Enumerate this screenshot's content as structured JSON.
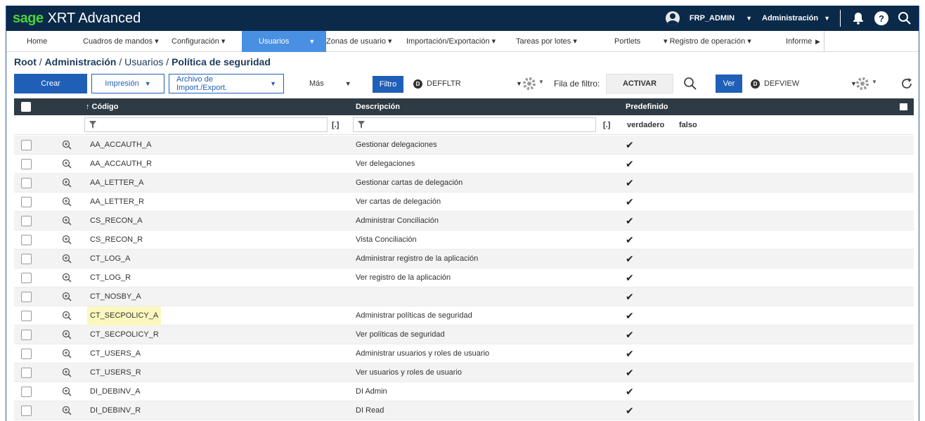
{
  "app": {
    "brand": "sage",
    "title": "XRT Advanced"
  },
  "topbar": {
    "user": "FRP_ADMIN",
    "role": "Administración",
    "icons": [
      "user-avatar-icon",
      "bell-icon",
      "help-icon",
      "search-icon"
    ]
  },
  "menu": {
    "home": "Home",
    "cuadros": "Cuadros de mandos ▾",
    "configuracion": "Configuración ▾",
    "usuarios": "Usuarios",
    "zonas": "Zonas de usuario ▾",
    "importacion": "Importación/Exportación ▾",
    "tareas": "Tareas por lotes ▾",
    "portlets": "Portlets",
    "registro": "▾ Registro de operación ▾",
    "informe": "Informe"
  },
  "breadcrumb": {
    "root": "Root",
    "sep1": " / ",
    "admin": "Administración",
    "sep2": " / ",
    "usuarios": "Usuarios",
    "sep3": " / ",
    "current": "Política de seguridad"
  },
  "toolbar": {
    "crear": "Crear",
    "impresion": "Impresión",
    "archivo": "Archivo de Import./Export.",
    "mas": "Más",
    "filtro": "Filtro",
    "filter_name": "DEFFLTR",
    "fila_label": "Fila de filtro:",
    "activar": "ACTIVAR",
    "ver": "Ver",
    "view_name": "DEFVIEW"
  },
  "table": {
    "col_code": "↑ Código",
    "col_desc": "Descripción",
    "col_default": "Predefinido",
    "filter_bracket": "[.]",
    "filter_true": "verdadero",
    "filter_false": "falso",
    "rows": [
      {
        "code": "AA_ACCAUTH_A",
        "desc": "Gestionar delegaciones",
        "default": "✔"
      },
      {
        "code": "AA_ACCAUTH_R",
        "desc": "Ver delegaciones",
        "default": "✔"
      },
      {
        "code": "AA_LETTER_A",
        "desc": "Gestionar cartas de delegación",
        "default": "✔"
      },
      {
        "code": "AA_LETTER_R",
        "desc": "Ver cartas de delegación",
        "default": "✔"
      },
      {
        "code": "CS_RECON_A",
        "desc": "Administrar Conciliación",
        "default": "✔"
      },
      {
        "code": "CS_RECON_R",
        "desc": "Vista Conciliación",
        "default": "✔"
      },
      {
        "code": "CT_LOG_A",
        "desc": "Administrar registro de la aplicación",
        "default": "✔"
      },
      {
        "code": "CT_LOG_R",
        "desc": "Ver registro de la aplicación",
        "default": "✔"
      },
      {
        "code": "CT_NOSBY_A",
        "desc": "",
        "default": "✔"
      },
      {
        "code": "CT_SECPOLICY_A",
        "desc": "Administrar políticas de seguridad",
        "default": "✔",
        "highlighted": true
      },
      {
        "code": "CT_SECPOLICY_R",
        "desc": "Ver políticas de seguridad",
        "default": "✔"
      },
      {
        "code": "CT_USERS_A",
        "desc": "Administrar usuarios y roles de usuario",
        "default": "✔"
      },
      {
        "code": "CT_USERS_R",
        "desc": "Ver usuarios y roles de usuario",
        "default": "✔"
      },
      {
        "code": "DI_DEBINV_A",
        "desc": "DI Admin",
        "default": "✔"
      },
      {
        "code": "DI_DEBINV_R",
        "desc": "DI Read",
        "default": "✔"
      }
    ]
  },
  "colors": {
    "topbar": "#0b2a4a",
    "brand_green": "#4cd137",
    "accent_blue": "#1f5fb8",
    "active_tab": "#4a90e2",
    "table_header": "#2e3b45",
    "highlight": "#fbf8bf"
  }
}
